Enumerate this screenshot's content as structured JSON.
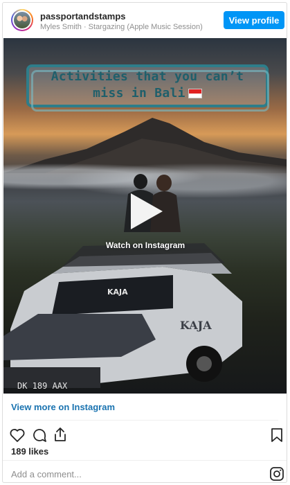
{
  "header": {
    "username": "passportandstamps",
    "subtitle": "Myles Smith · Stargazing (Apple Music Session)",
    "view_profile_label": "View profile"
  },
  "media": {
    "overlay_title": "Activities that you can’t miss in Bali",
    "watch_label": "Watch on Instagram",
    "jeep_brand": "KAJA",
    "plate": "DK 189 AAX"
  },
  "footer": {
    "view_more_label": "View more on Instagram",
    "likes": "189 likes",
    "comment_placeholder": "Add a comment..."
  },
  "colors": {
    "accent": "#0095f6",
    "link": "#1a73b0",
    "overlay_teal": "#2e7d8a"
  },
  "icons": [
    "heart-icon",
    "comment-icon",
    "share-icon",
    "bookmark-icon",
    "instagram-icon",
    "play-icon",
    "bali-flag-icon"
  ]
}
